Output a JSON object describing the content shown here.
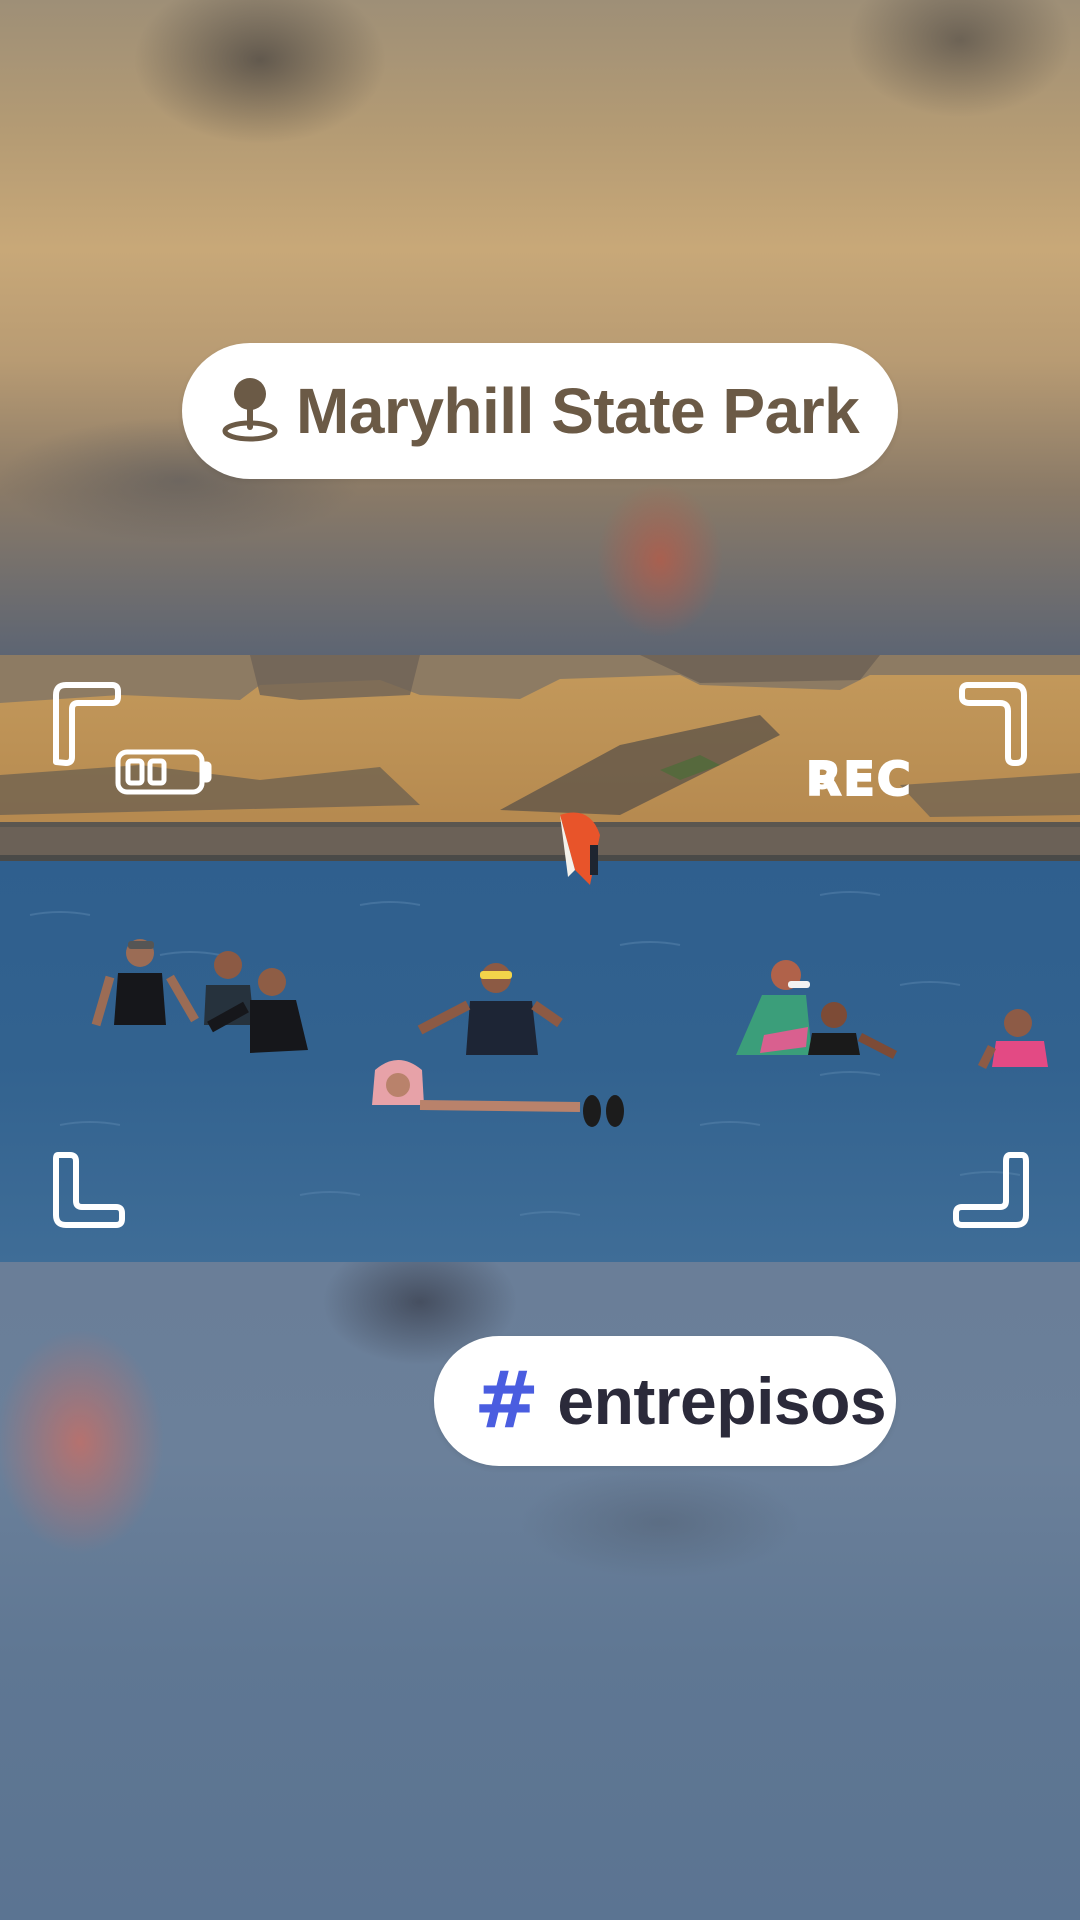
{
  "location_tag": {
    "text": "Maryhill State Park",
    "icon": "map-pin-icon",
    "text_color": "#6b5a46"
  },
  "hashtag_tag": {
    "text": "entrepisos",
    "icon": "hashtag-icon",
    "icon_color": "#4a5de0"
  },
  "camera_overlay": {
    "recording_label": "REC",
    "icons": [
      "battery-icon",
      "recording-dot-icon",
      "viewfinder-corner-icon"
    ]
  },
  "photo": {
    "subject": "beach-water-scene"
  }
}
